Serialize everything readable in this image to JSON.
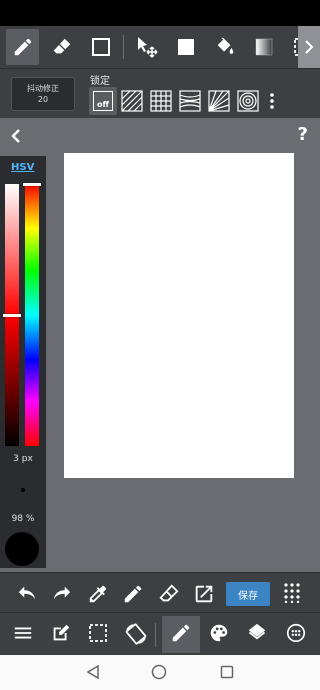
{
  "toolbar_top": {
    "icons": [
      "pen-icon",
      "eraser-icon",
      "rectangle-icon",
      "move-icon",
      "fill-square-icon",
      "bucket-icon",
      "gradient-icon",
      "select-icon"
    ],
    "scroll_arrow": "chevron-right-icon"
  },
  "toolbar_settings": {
    "stabilizer_label": "抖动修正",
    "stabilizer_value": "20",
    "lock_label": "锁定",
    "lock_off": "off",
    "lock_options": [
      "off",
      "parallel",
      "grid",
      "perspective",
      "radial",
      "concentric"
    ]
  },
  "canvas": {
    "help": "?",
    "color_mode": "HSV",
    "brush_size": "3 px",
    "opacity": "98 %",
    "current_color": "#000000",
    "sv_level": 0.5,
    "hue_level": 0.0
  },
  "toolbar_bottom": {
    "save_label": "保存",
    "icons": [
      "undo-icon",
      "redo-icon",
      "eyedropper-icon",
      "pen-icon",
      "eraser-icon",
      "export-icon",
      "grid-dots-icon"
    ]
  },
  "toolbar_main": {
    "icons": [
      "menu-icon",
      "edit-icon",
      "selection-icon",
      "rotate-icon",
      "brush-icon",
      "palette-icon",
      "layers-icon",
      "material-icon"
    ]
  },
  "colors": {
    "accent": "#3c85c4",
    "bar": "#3d3f43",
    "canvas_bg": "#6a6c71"
  }
}
